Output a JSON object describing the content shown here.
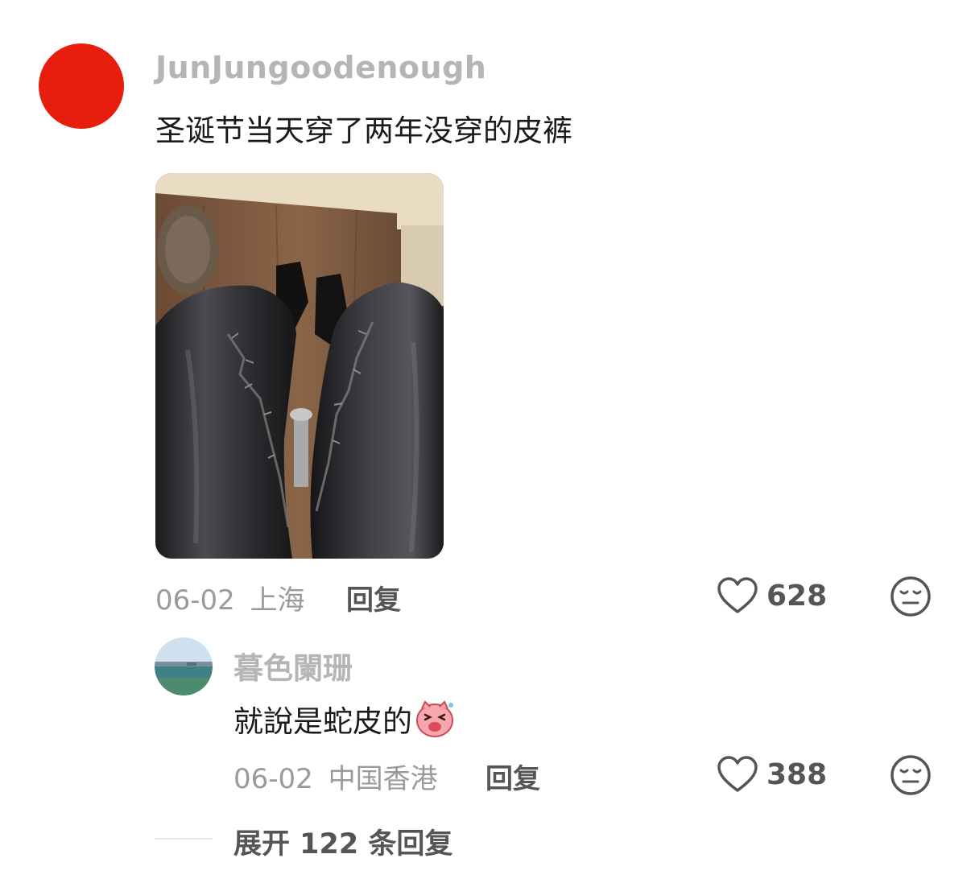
{
  "comment": {
    "username": "JunJungoodenough",
    "text": "圣诞节当天穿了两年没穿的皮裤",
    "date": "06-02",
    "location": "上海",
    "reply_label": "回复",
    "likes": "628",
    "avatar_color": "#e81e0c"
  },
  "reply": {
    "username": "暮色闌珊",
    "text": "就說是蛇皮的",
    "emoji": "laughing-pig-emoji",
    "date": "06-02",
    "location": "中国香港",
    "reply_label": "回复",
    "likes": "388"
  },
  "expand_label": "展开 122 条回复",
  "icons": {
    "like": "heart-outline-icon",
    "dislike": "meh-face-icon"
  }
}
